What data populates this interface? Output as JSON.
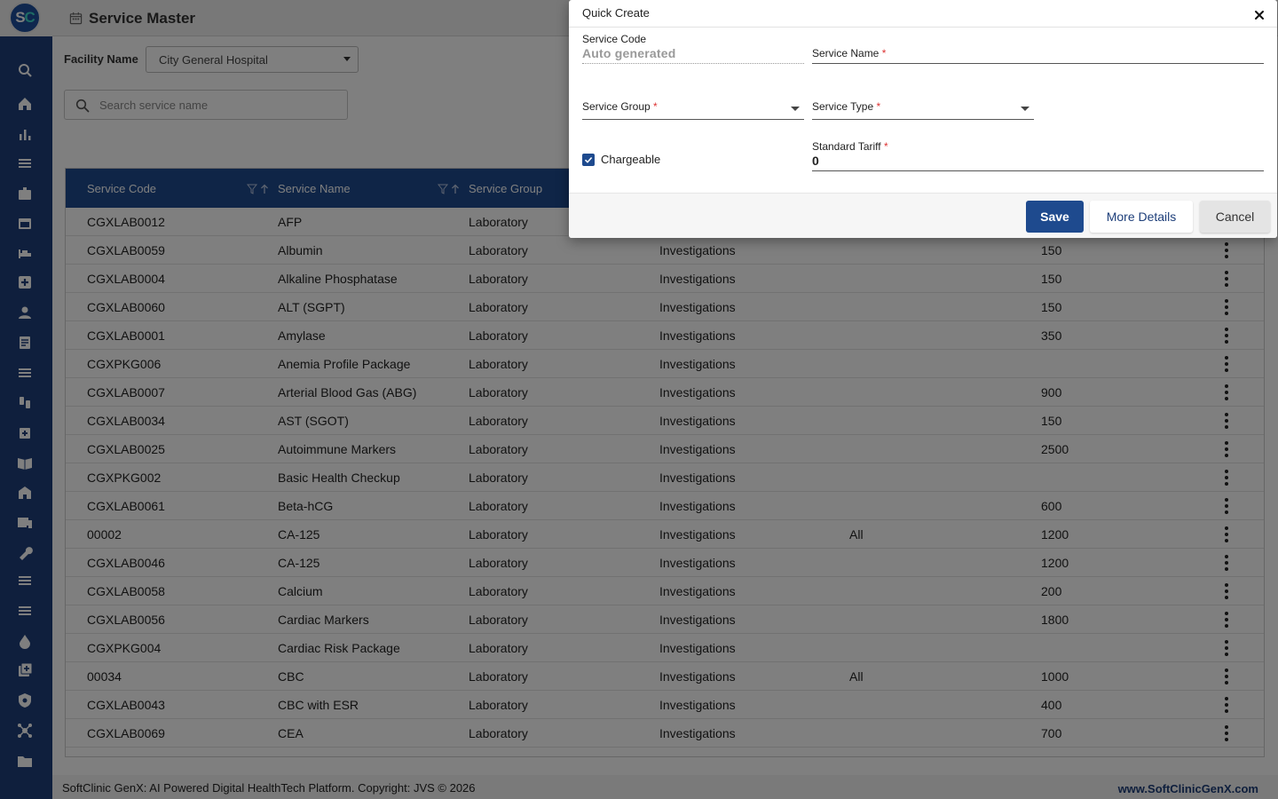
{
  "app": {
    "logo_text": "SC",
    "page_title": "Service Master"
  },
  "sidebar": {
    "icons": [
      "search-icon",
      "home-icon",
      "bar-chart-icon",
      "menu-icon",
      "badge-icon",
      "calendar-icon",
      "bed-icon",
      "medical-plus-icon",
      "person-icon",
      "document-icon",
      "list-icon",
      "iv-drip-icon",
      "medicine-box-icon",
      "book-icon",
      "building-icon",
      "devices-icon",
      "wrench-icon",
      "list-icon",
      "list-icon",
      "drop-icon",
      "add-box-icon",
      "shield-icon",
      "hub-icon",
      "folder-icon"
    ]
  },
  "filters": {
    "facility_label": "Facility Name",
    "facility_value": "City General Hospital",
    "search_placeholder": "Search service name"
  },
  "table": {
    "headers": [
      "Service Code",
      "Service Name",
      "Service Group"
    ],
    "rows": [
      {
        "code": "CGXLAB0012",
        "name": "AFP",
        "group": "Laboratory",
        "type": "",
        "applicable": "",
        "tariff": ""
      },
      {
        "code": "CGXLAB0059",
        "name": "Albumin",
        "group": "Laboratory",
        "type": "Investigations",
        "applicable": "",
        "tariff": "150"
      },
      {
        "code": "CGXLAB0004",
        "name": "Alkaline Phosphatase",
        "group": "Laboratory",
        "type": "Investigations",
        "applicable": "",
        "tariff": "150"
      },
      {
        "code": "CGXLAB0060",
        "name": "ALT (SGPT)",
        "group": "Laboratory",
        "type": "Investigations",
        "applicable": "",
        "tariff": "150"
      },
      {
        "code": "CGXLAB0001",
        "name": "Amylase",
        "group": "Laboratory",
        "type": "Investigations",
        "applicable": "",
        "tariff": "350"
      },
      {
        "code": "CGXPKG006",
        "name": "Anemia Profile Package",
        "group": "Laboratory",
        "type": "Investigations",
        "applicable": "",
        "tariff": ""
      },
      {
        "code": "CGXLAB0007",
        "name": "Arterial Blood Gas (ABG)",
        "group": "Laboratory",
        "type": "Investigations",
        "applicable": "",
        "tariff": "900"
      },
      {
        "code": "CGXLAB0034",
        "name": "AST (SGOT)",
        "group": "Laboratory",
        "type": "Investigations",
        "applicable": "",
        "tariff": "150"
      },
      {
        "code": "CGXLAB0025",
        "name": "Autoimmune Markers",
        "group": "Laboratory",
        "type": "Investigations",
        "applicable": "",
        "tariff": "2500"
      },
      {
        "code": "CGXPKG002",
        "name": "Basic Health Checkup",
        "group": "Laboratory",
        "type": "Investigations",
        "applicable": "",
        "tariff": ""
      },
      {
        "code": "CGXLAB0061",
        "name": "Beta-hCG",
        "group": "Laboratory",
        "type": "Investigations",
        "applicable": "",
        "tariff": "600"
      },
      {
        "code": "00002",
        "name": "CA-125",
        "group": "Laboratory",
        "type": "Investigations",
        "applicable": "All",
        "tariff": "1200"
      },
      {
        "code": "CGXLAB0046",
        "name": "CA-125",
        "group": "Laboratory",
        "type": "Investigations",
        "applicable": "",
        "tariff": "1200"
      },
      {
        "code": "CGXLAB0058",
        "name": "Calcium",
        "group": "Laboratory",
        "type": "Investigations",
        "applicable": "",
        "tariff": "200"
      },
      {
        "code": "CGXLAB0056",
        "name": "Cardiac Markers",
        "group": "Laboratory",
        "type": "Investigations",
        "applicable": "",
        "tariff": "1800"
      },
      {
        "code": "CGXPKG004",
        "name": "Cardiac Risk Package",
        "group": "Laboratory",
        "type": "Investigations",
        "applicable": "",
        "tariff": ""
      },
      {
        "code": "00034",
        "name": "CBC",
        "group": "Laboratory",
        "type": "Investigations",
        "applicable": "All",
        "tariff": "1000"
      },
      {
        "code": "CGXLAB0043",
        "name": "CBC with ESR",
        "group": "Laboratory",
        "type": "Investigations",
        "applicable": "",
        "tariff": "400"
      },
      {
        "code": "CGXLAB0069",
        "name": "CEA",
        "group": "Laboratory",
        "type": "Investigations",
        "applicable": "",
        "tariff": "700"
      }
    ]
  },
  "dialog": {
    "title": "Quick Create",
    "service_code_label": "Service Code",
    "service_code_value": "Auto generated",
    "service_name_label": "Service Name",
    "service_group_label": "Service Group",
    "service_type_label": "Service Type",
    "chargeable_label": "Chargeable",
    "chargeable_checked": true,
    "standard_tariff_label": "Standard Tariff",
    "standard_tariff_value": "0",
    "required_marker": "*",
    "save_label": "Save",
    "more_details_label": "More Details",
    "cancel_label": "Cancel"
  },
  "footer": {
    "text": "SoftClinic GenX: AI Powered Digital HealthTech Platform. Copyright: JVS © 2026",
    "link": "www.SoftClinicGenX.com"
  },
  "colors": {
    "sidebar": "#1e3f7a",
    "table_header": "#1e4a8e",
    "save_button": "#1e4a8e",
    "required": "#dd3333"
  }
}
